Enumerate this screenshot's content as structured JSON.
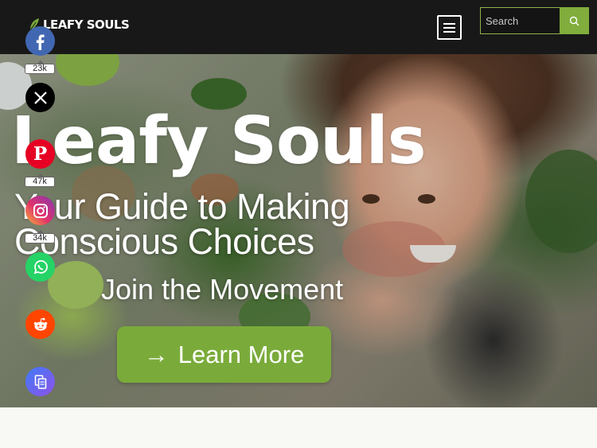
{
  "brand": {
    "logo_text": "LEAFY SOULS",
    "accent": "#80ad3c"
  },
  "header": {
    "menu_icon": "hamburger-menu-icon"
  },
  "search": {
    "placeholder": "Search",
    "button_icon": "search-icon"
  },
  "hero": {
    "title": "Leafy Souls",
    "subtitle_line1": "Your Guide to Making",
    "subtitle_line2": "Conscious Choices",
    "tagline": "Join the Movement",
    "cta_arrow": "→",
    "cta_label": "Learn More"
  },
  "social": {
    "facebook": {
      "icon": "facebook-icon",
      "count": "23k",
      "color": "#4267b2"
    },
    "x": {
      "icon": "x-icon",
      "color": "#000000"
    },
    "pinterest": {
      "icon": "pinterest-icon",
      "count": "47k",
      "color": "#e60023"
    },
    "instagram": {
      "icon": "instagram-icon",
      "count": "34k",
      "color": "#c13584"
    },
    "whatsapp": {
      "icon": "whatsapp-icon",
      "color": "#25d366"
    },
    "reddit": {
      "icon": "reddit-icon",
      "color": "#ff4500"
    },
    "copy": {
      "icon": "copy-icon",
      "color": "#5b6cf0"
    }
  }
}
